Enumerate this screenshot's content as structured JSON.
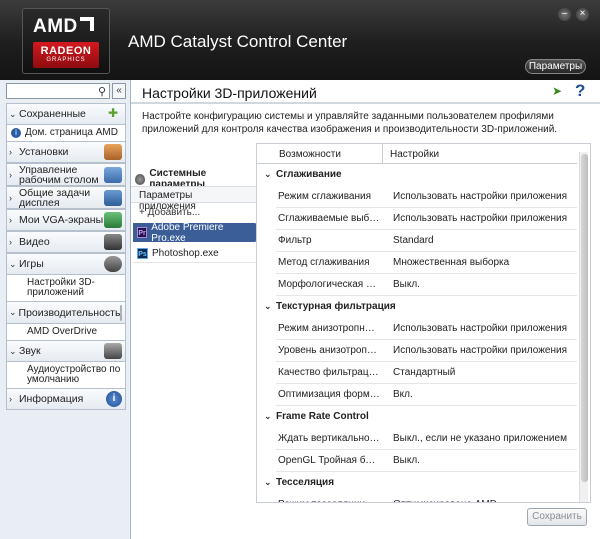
{
  "header": {
    "logo_amd": "AMD",
    "logo_radeon": "RADEON",
    "logo_graphics": "GRAPHICS",
    "app_title": "AMD Catalyst Control Center",
    "settings_button": "Параметры",
    "minimize": "–",
    "close": "×"
  },
  "sidebar": {
    "search_placeholder": "",
    "collapse_label": "«",
    "items": [
      {
        "label": "Сохраненные",
        "icon": "pin-icon",
        "color": "#5aa02c"
      },
      {
        "label": "Дом. страница AMD",
        "icon": "info-icon",
        "sub": true
      },
      {
        "label": "Установки",
        "icon": "presets-icon",
        "color": "#c87a3a"
      },
      {
        "label": "Управление рабочим столом",
        "icon": "desktop-icon",
        "color": "#4a7ab8"
      },
      {
        "label": "Общие задачи дисплея",
        "icon": "display-icon",
        "color": "#3b6fa8"
      },
      {
        "label": "Мои VGA-экраны",
        "icon": "vga-icon",
        "color": "#3a9a4a"
      },
      {
        "label": "Видео",
        "icon": "video-icon",
        "color": "#555555"
      },
      {
        "label": "Игры",
        "icon": "gamepad-icon",
        "color": "#666666"
      },
      {
        "label": "Настройки 3D-приложений",
        "sub": true
      },
      {
        "label": "Производительность",
        "icon": "gauge-icon",
        "color": "#777777"
      },
      {
        "label": "AMD OverDrive",
        "sub": true
      },
      {
        "label": "Звук",
        "icon": "speaker-icon",
        "color": "#666666"
      },
      {
        "label": "Аудиоустройство по умолчанию",
        "sub": true
      },
      {
        "label": "Информация",
        "icon": "info-icon",
        "color": "#2b5da6"
      }
    ]
  },
  "main": {
    "title": "Настройки 3D-приложений",
    "description": "Настройте конфигурацию системы и управляйте заданными пользователем профилями приложений для контроля качества изображения и производительности 3D-приложений.",
    "system_params": "Системные параметры",
    "app_params": "Параметры приложения",
    "add": "Добавить...",
    "apps": [
      "Adobe Premiere Pro.exe",
      "Photoshop.exe"
    ],
    "table": {
      "col_feature": "Возможности",
      "col_settings": "Настройки",
      "groups": [
        {
          "name": "Сглаживание",
          "rows": [
            {
              "f": "Режим сглаживания",
              "v": "Использовать настройки приложения"
            },
            {
              "f": "Сглаживаемые выборки",
              "v": "Использовать настройки приложения"
            },
            {
              "f": "Фильтр",
              "v": "Standard"
            },
            {
              "f": "Метод сглаживания",
              "v": "Множественная выборка"
            },
            {
              "f": "Морфологическая фил...",
              "v": "Выкл."
            }
          ]
        },
        {
          "name": "Текстурная фильтрация",
          "rows": [
            {
              "f": "Режим анизотропной...",
              "v": "Использовать настройки приложения"
            },
            {
              "f": "Уровень анизотропной...",
              "v": "Использовать настройки приложения"
            },
            {
              "f": "Качество фильтрации т...",
              "v": "Стандартный"
            },
            {
              "f": "Оптимизация формата...",
              "v": "Вкл."
            }
          ]
        },
        {
          "name": "Frame Rate Control",
          "rows": [
            {
              "f": "Ждать вертикального о...",
              "v": "Выкл., если не указано приложением"
            },
            {
              "f": "OpenGL Тройная буфер...",
              "v": "Выкл."
            }
          ]
        },
        {
          "name": "Тесселяция",
          "rows": [
            {
              "f": "Режим тесселяции",
              "v": "Оптимизировано AMD"
            }
          ]
        }
      ]
    },
    "save_button": "Сохранить"
  }
}
